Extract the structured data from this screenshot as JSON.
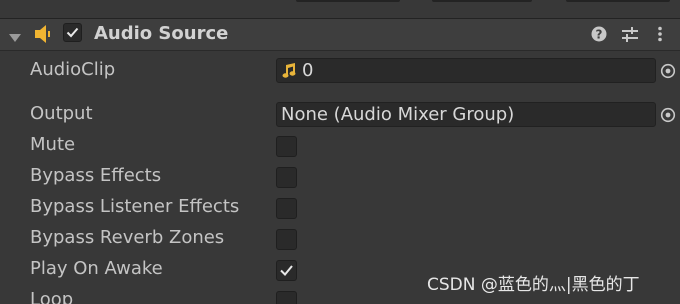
{
  "component": {
    "title": "Audio Source",
    "enabled": true
  },
  "properties": {
    "audio_clip": {
      "label": "AudioClip",
      "value": "0"
    },
    "output": {
      "label": "Output",
      "value": "None (Audio Mixer Group)"
    },
    "mute": {
      "label": "Mute",
      "checked": false
    },
    "bypass_effects": {
      "label": "Bypass Effects",
      "checked": false
    },
    "bypass_listener_effects": {
      "label": "Bypass Listener Effects",
      "checked": false
    },
    "bypass_reverb_zones": {
      "label": "Bypass Reverb Zones",
      "checked": false
    },
    "play_on_awake": {
      "label": "Play On Awake",
      "checked": true
    },
    "loop": {
      "label": "Loop",
      "checked": false
    }
  },
  "icons": {
    "fold": "triangle-down-icon",
    "component": "speaker-icon",
    "help": "help-icon",
    "presets": "sliders-icon",
    "menu": "kebab-menu-icon",
    "picker": "object-picker-icon",
    "clip": "music-note-icon"
  },
  "colors": {
    "background": "#383838",
    "header": "#3e3e3e",
    "field": "#2a2a2a",
    "accent_speaker": "#f0b432"
  },
  "watermark": {
    "text": "CSDN @蓝色的灬|黑色的丁"
  }
}
